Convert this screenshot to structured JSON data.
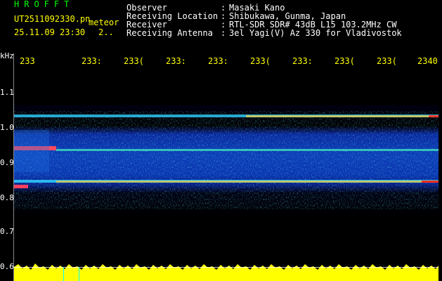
{
  "header": {
    "app_title": "HROFFT",
    "file_name": "UT2511092330.pn",
    "mode": "meteor",
    "datetime": "25.11.09 23:30",
    "counter": "2..",
    "meta": [
      {
        "label": "Observer",
        "sep": ":",
        "value": "Masaki Kano"
      },
      {
        "label": "Receiving Location",
        "sep": ":",
        "value": "Shibukawa, Gunma, Japan"
      },
      {
        "label": "Receiver",
        "sep": ":",
        "value": "RTL-SDR SDR# 43dB L15 103.2MHz CW"
      },
      {
        "label": "Receiving Antenna",
        "sep": ":",
        "value": "3el Yagi(V) Az 330 for Vladivostok"
      }
    ]
  },
  "y_axis": {
    "unit": "kHz",
    "ticks": [
      "1.1",
      "1.0",
      "0.9",
      "0.8",
      "0.7",
      "0.6"
    ]
  },
  "x_axis": {
    "ticks": [
      "233",
      "233:",
      "233(",
      "233:",
      "233:",
      "233(",
      "233:",
      "233(",
      "233(",
      "2340"
    ]
  },
  "colors": {
    "header_label": "#ffffff",
    "title": "#00ff00",
    "axis_text": "#ffff00",
    "background": "#000000"
  }
}
